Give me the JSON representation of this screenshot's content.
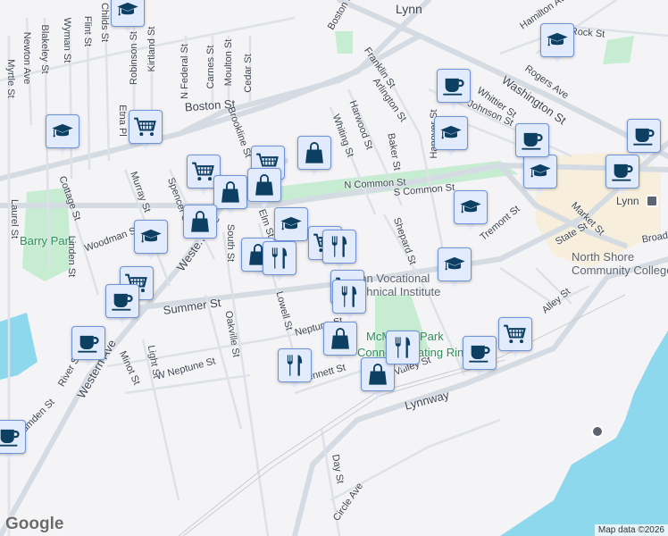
{
  "places": {
    "city": "Lynn",
    "station": "Lynn"
  },
  "parks": [
    "Barry Park",
    "McManus Park",
    "Connery Skating Rink"
  ],
  "pois": [
    "Lynn Vocational",
    "Technical Institute",
    "North Shore",
    "Community College"
  ],
  "streets": [
    "Myrtle St",
    "Blakeley St",
    "Newton Ave",
    "Wyman St",
    "Flint St",
    "Childs St",
    "Robinson St",
    "Kirtland St",
    "N Federal St",
    "Carnes St",
    "Moulton St",
    "Cedar St",
    "Boston St",
    "Etna Pl",
    "Brookline St",
    "Cottage St",
    "Laurel St",
    "Murray St",
    "Spencer St",
    "Woodman St",
    "Western Ave",
    "South St",
    "Elm St",
    "Franklin St",
    "Arlington St",
    "Harwood St",
    "Whiting St",
    "Baker St",
    "Hanover St",
    "Whittier St",
    "Johnson St",
    "Washington St",
    "Rogers Ave",
    "Rock St",
    "Hamilton Ave",
    "N Common St",
    "S Common St",
    "Shepard St",
    "Tremont St",
    "Market St",
    "State St",
    "Alley St",
    "Lynnway",
    "Day St",
    "Circle Ave",
    "Summer St",
    "Linden St",
    "Oakville St",
    "Lowell St",
    "Neptune St",
    "Light St",
    "Minot St",
    "W Neptune St",
    "Western Ave",
    "River St",
    "Camden St",
    "Bennett St",
    "Valley St",
    "Boston St",
    "Broad St"
  ],
  "markers": [
    {
      "type": "school"
    },
    {
      "type": "school"
    },
    {
      "type": "school"
    },
    {
      "type": "school"
    },
    {
      "type": "school"
    },
    {
      "type": "school"
    },
    {
      "type": "school"
    },
    {
      "type": "school"
    },
    {
      "type": "school"
    },
    {
      "type": "cart"
    },
    {
      "type": "cart"
    },
    {
      "type": "cart"
    },
    {
      "type": "cart"
    },
    {
      "type": "cart"
    },
    {
      "type": "cart"
    },
    {
      "type": "cart"
    },
    {
      "type": "bag"
    },
    {
      "type": "bag"
    },
    {
      "type": "bag"
    },
    {
      "type": "bag"
    },
    {
      "type": "bag"
    },
    {
      "type": "bag"
    },
    {
      "type": "bag"
    },
    {
      "type": "cup"
    },
    {
      "type": "cup"
    },
    {
      "type": "cup"
    },
    {
      "type": "cup"
    },
    {
      "type": "cup"
    },
    {
      "type": "cup"
    },
    {
      "type": "cup"
    },
    {
      "type": "cup"
    },
    {
      "type": "restaurant"
    },
    {
      "type": "restaurant"
    },
    {
      "type": "restaurant"
    },
    {
      "type": "restaurant"
    },
    {
      "type": "restaurant"
    }
  ],
  "colors": {
    "marker_fill": "#e2ebfb",
    "marker_border": "#6f93d8",
    "icon": "#0d3f63",
    "water": "#8ed8ee",
    "park": "#c6ecd2",
    "road": "#d5dbe3"
  },
  "attribution": "Map data ©2026",
  "logo": "Google"
}
